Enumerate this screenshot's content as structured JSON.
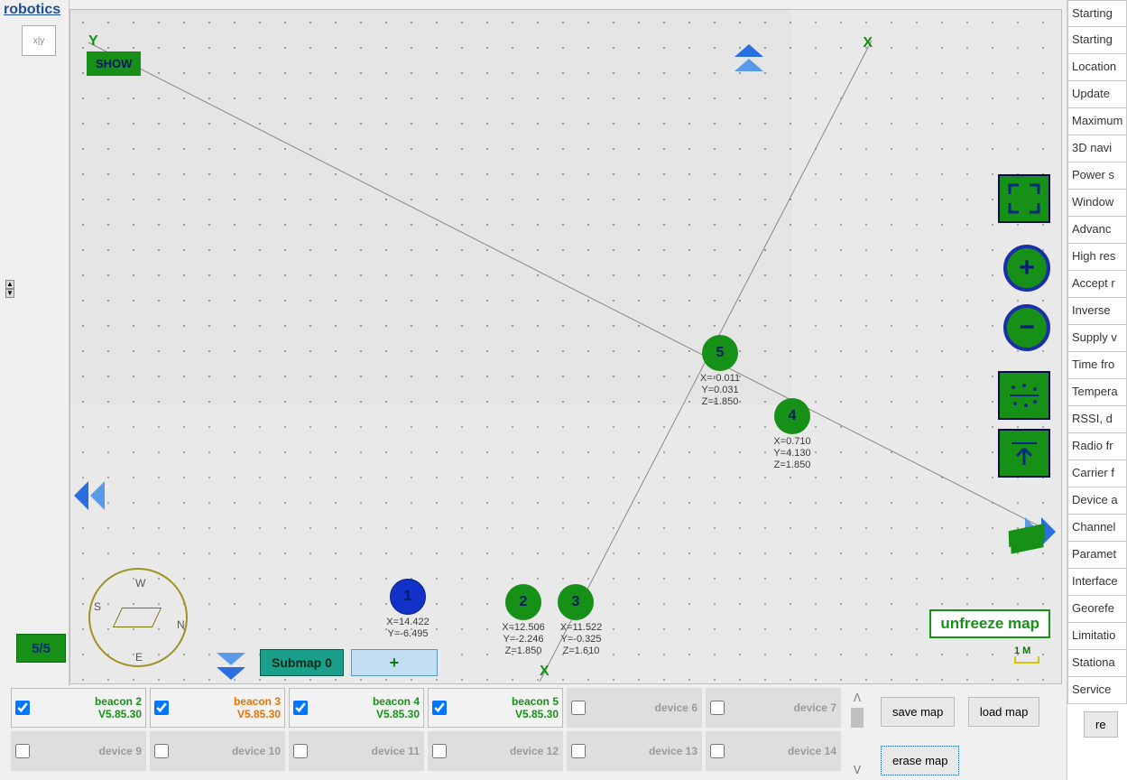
{
  "brand": "robotics",
  "xy_icon_label": "x|y",
  "ratio_badge": "5/5",
  "canvas": {
    "axis_y": "Y",
    "axis_x_top": "X",
    "axis_x_bot": "X",
    "show_label": "SHOW",
    "unfreeze_label": "unfreeze map",
    "scale_label": "1 M"
  },
  "submap": {
    "label": "Submap 0",
    "add": "+"
  },
  "compass": {
    "n": "N",
    "s": "S",
    "e": "E",
    "w": "W"
  },
  "nodes": {
    "n1": {
      "id": "1",
      "x": "X=14.422",
      "y": "Y=-6.495"
    },
    "n2": {
      "id": "2",
      "x": "X=12.506",
      "y": "Y=-2.246",
      "z": "Z=1.850"
    },
    "n3": {
      "id": "3",
      "x": "X=11.522",
      "y": "Y=-0.325",
      "z": "Z=1.610"
    },
    "n4": {
      "id": "4",
      "x": "X=0.710",
      "y": "Y=4.130",
      "z": "Z=1.850"
    },
    "n5": {
      "id": "5",
      "x": "X=-0.011",
      "y": "Y=0.031",
      "z": "Z=1.850"
    }
  },
  "devices_top": [
    {
      "name": "beacon 2",
      "ver": "V5.85.30",
      "checked": true,
      "cls": "g bordered"
    },
    {
      "name": "beacon 3",
      "ver": "V5.85.30",
      "checked": true,
      "cls": "o bordered"
    },
    {
      "name": "beacon 4",
      "ver": "V5.85.30",
      "checked": true,
      "cls": "g bordered"
    },
    {
      "name": "beacon 5",
      "ver": "V5.85.30",
      "checked": true,
      "cls": "g bordered"
    },
    {
      "name": "device 6",
      "ver": "",
      "checked": false,
      "cls": "dim"
    },
    {
      "name": "device 7",
      "ver": "",
      "checked": false,
      "cls": "dim"
    }
  ],
  "devices_bot": [
    {
      "name": "device 9",
      "ver": "",
      "checked": false,
      "cls": "dim"
    },
    {
      "name": "device 10",
      "ver": "",
      "checked": false,
      "cls": "dim"
    },
    {
      "name": "device 11",
      "ver": "",
      "checked": false,
      "cls": "dim"
    },
    {
      "name": "device 12",
      "ver": "",
      "checked": false,
      "cls": "dim"
    },
    {
      "name": "device 13",
      "ver": "",
      "checked": false,
      "cls": "dim"
    },
    {
      "name": "device 14",
      "ver": "",
      "checked": false,
      "cls": "dim"
    }
  ],
  "map_buttons": {
    "save": "save map",
    "load": "load map",
    "erase": "erase map"
  },
  "settings_rows": [
    "Starting",
    "Starting",
    "Location",
    "Update",
    "Maximum",
    "3D navi",
    "Power s",
    "Window",
    "Advanc",
    "High res",
    "Accept r",
    "Inverse",
    "Supply v",
    "Time fro",
    "Tempera",
    "RSSI, d",
    "Radio fr",
    "Carrier f",
    "Device a",
    "Channel",
    "Paramet",
    "Interface",
    "Georefe",
    "Limitatio",
    "Stationa",
    "Service"
  ],
  "settings_button": "re",
  "zoom": {
    "plus": "+",
    "minus": "−",
    "up": "↑"
  }
}
